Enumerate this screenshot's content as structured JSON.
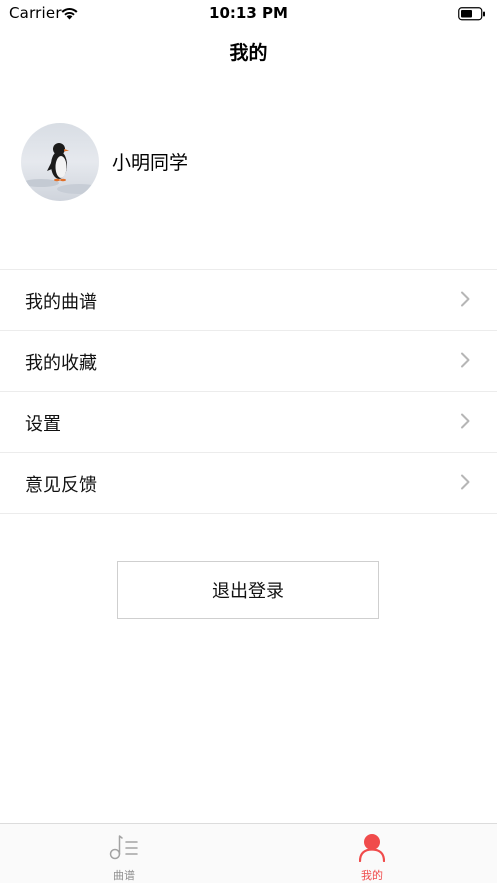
{
  "status_bar": {
    "carrier": "Carrier",
    "time": "10:13 PM"
  },
  "nav": {
    "title": "我的"
  },
  "profile": {
    "name": "小明同学"
  },
  "menu": {
    "items": [
      {
        "label": "我的曲谱"
      },
      {
        "label": "我的收藏"
      },
      {
        "label": "设置"
      },
      {
        "label": "意见反馈"
      }
    ]
  },
  "logout": {
    "label": "退出登录"
  },
  "tab_bar": {
    "tabs": [
      {
        "label": "曲谱",
        "icon": "music-note-icon",
        "selected": false
      },
      {
        "label": "我的",
        "icon": "person-icon",
        "selected": true
      }
    ]
  },
  "colors": {
    "accent": "#f04b4b",
    "inactive": "#8e8e8e",
    "divider": "#ececec"
  }
}
